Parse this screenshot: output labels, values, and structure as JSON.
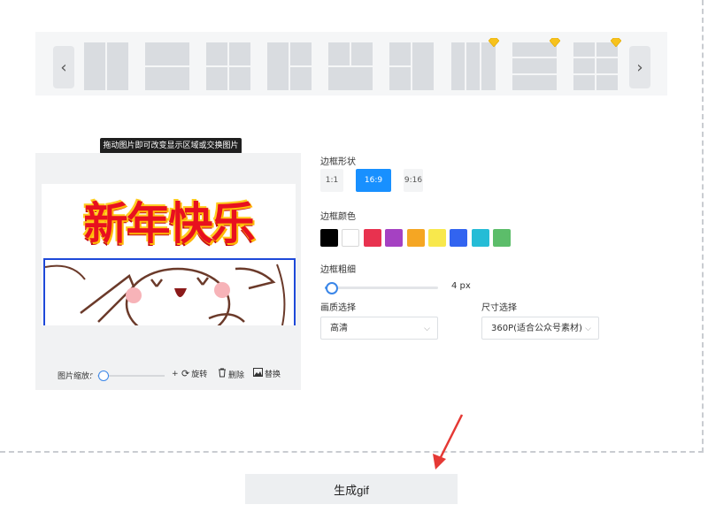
{
  "layouts": [
    {
      "name": "layout-two-columns",
      "premium": false
    },
    {
      "name": "layout-two-rows",
      "premium": false
    },
    {
      "name": "layout-four-grid",
      "premium": false
    },
    {
      "name": "layout-one-plus-two",
      "premium": false
    },
    {
      "name": "layout-top-two-bottom-one",
      "premium": false
    },
    {
      "name": "layout-left-two-right-one",
      "premium": false
    },
    {
      "name": "layout-three-columns",
      "premium": true
    },
    {
      "name": "layout-three-rows",
      "premium": true
    },
    {
      "name": "layout-six-grid",
      "premium": true
    }
  ],
  "editor": {
    "tooltip": "拖动图片即可改变显示区域或交换图片位置",
    "image_text": "新年快乐",
    "zoom_label": "图片缩放:",
    "zoom_minus": "-",
    "zoom_plus": "+",
    "rotate_label": "旋转",
    "delete_label": "删除",
    "replace_label": "替换"
  },
  "settings": {
    "shape_label": "边框形状",
    "ratios": [
      {
        "label": "1:1",
        "active": false
      },
      {
        "label": "16:9",
        "active": true
      },
      {
        "label": "9:16",
        "active": false
      }
    ],
    "color_label": "边框颜色",
    "colors": [
      "#000000",
      "#ffffff",
      "#e8324f",
      "#a541c2",
      "#f5a623",
      "#f8e84c",
      "#3264f0",
      "#25bcd6",
      "#5cbd6a"
    ],
    "thickness_label": "边框粗细",
    "thickness_value": "4 px",
    "thickness_fraction": 0.05,
    "quality_label": "画质选择",
    "quality_value": "高清",
    "size_label": "尺寸选择",
    "size_value": "360P(适合公众号素材)"
  },
  "generate_button": "生成gif",
  "colors": {
    "accent": "#1890ff",
    "selection": "#1e49d9",
    "annotation": "#e53935"
  }
}
